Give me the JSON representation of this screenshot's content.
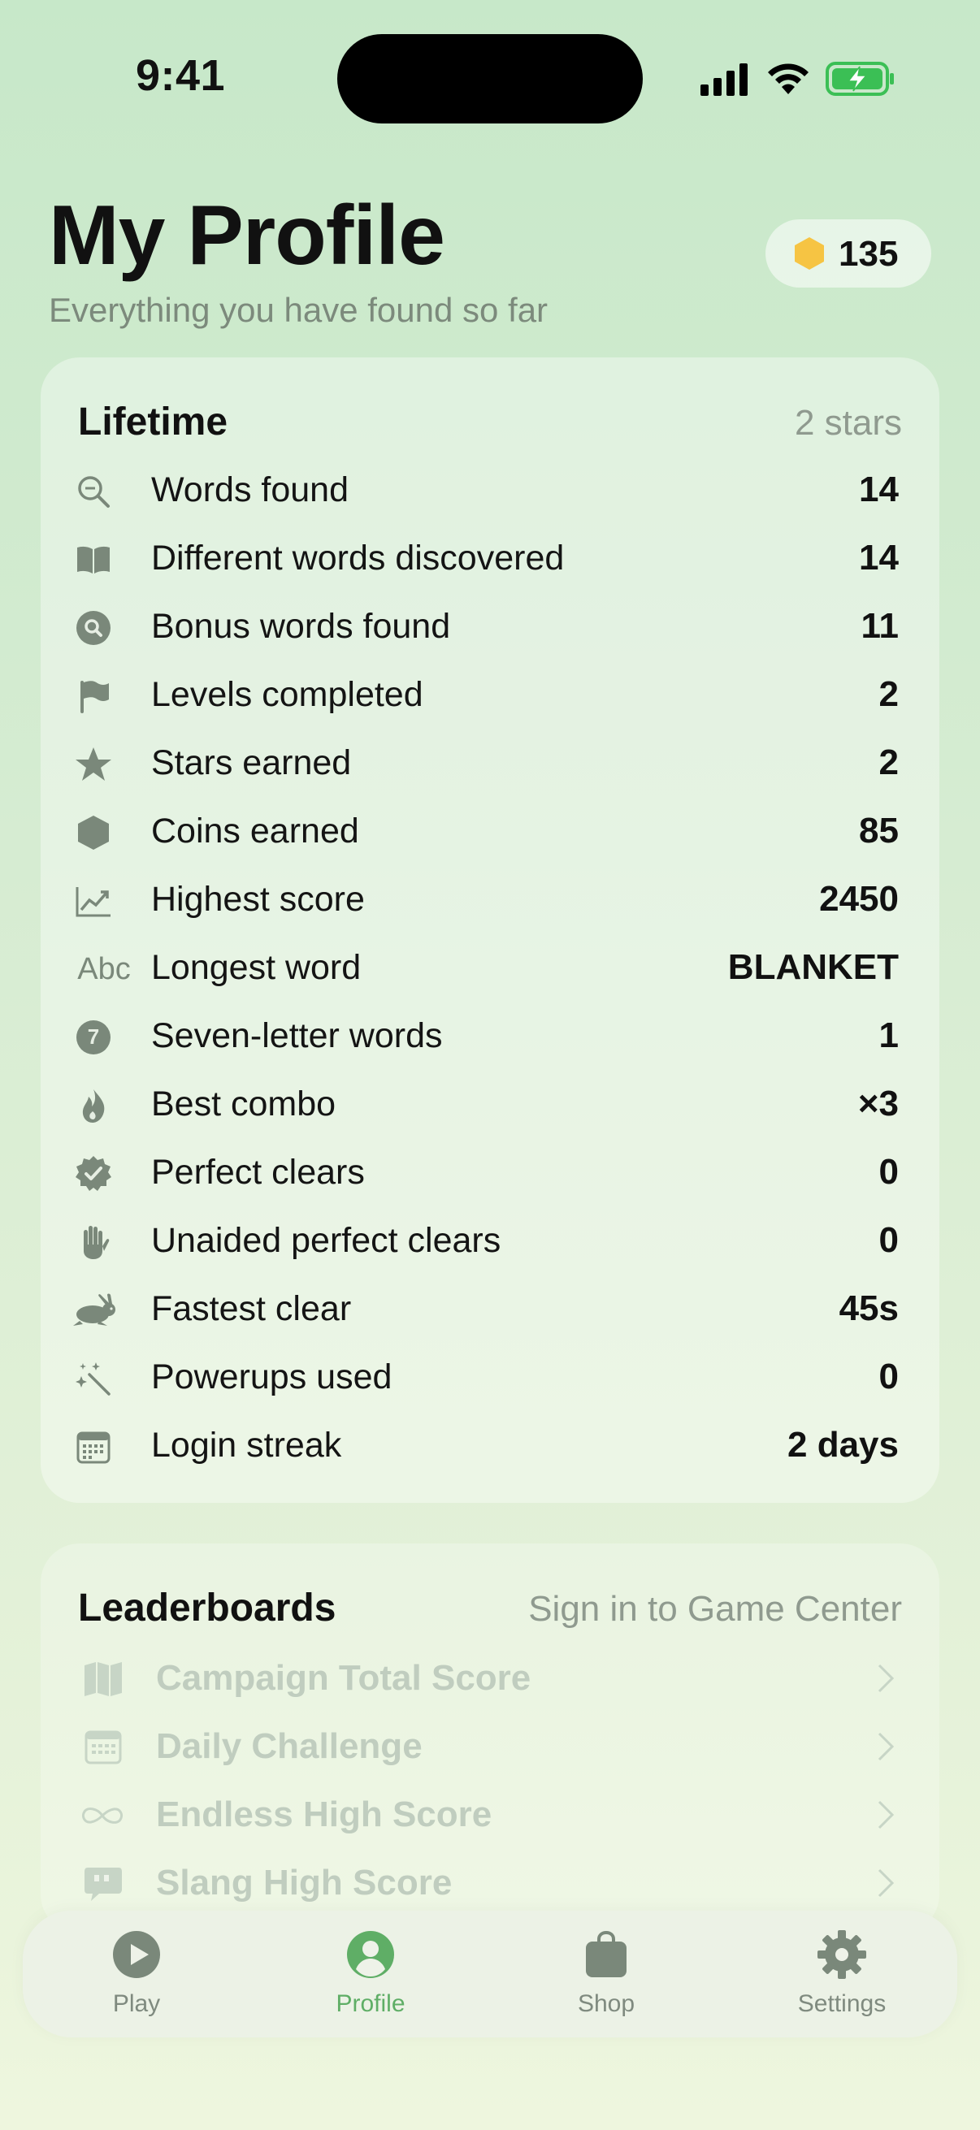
{
  "status_bar": {
    "time": "9:41"
  },
  "header": {
    "title": "My Profile",
    "subtitle": "Everything you have found so far",
    "coins": "135"
  },
  "lifetime": {
    "title": "Lifetime",
    "aside": "2 stars",
    "rows": [
      {
        "icon": "magnifier-icon",
        "label": "Words found",
        "value": "14"
      },
      {
        "icon": "book-icon",
        "label": "Different words discovered",
        "value": "14"
      },
      {
        "icon": "search-circle-icon",
        "label": "Bonus words found",
        "value": "11"
      },
      {
        "icon": "flag-icon",
        "label": "Levels completed",
        "value": "2"
      },
      {
        "icon": "star-icon",
        "label": "Stars earned",
        "value": "2"
      },
      {
        "icon": "hexagon-icon",
        "label": "Coins earned",
        "value": "85"
      },
      {
        "icon": "chart-up-icon",
        "label": "Highest score",
        "value": "2450"
      },
      {
        "icon": "abc-icon",
        "icon_text": "Abc",
        "label": "Longest word",
        "value": "BLANKET"
      },
      {
        "icon": "seven-circle-icon",
        "icon_text": "7",
        "label": "Seven-letter words",
        "value": "1"
      },
      {
        "icon": "flame-icon",
        "label": "Best combo",
        "value": "×3"
      },
      {
        "icon": "checkmark-seal-icon",
        "label": "Perfect clears",
        "value": "0"
      },
      {
        "icon": "hand-icon",
        "label": "Unaided perfect clears",
        "value": "0"
      },
      {
        "icon": "hare-icon",
        "label": "Fastest clear",
        "value": "45s"
      },
      {
        "icon": "magic-wand-icon",
        "label": "Powerups used",
        "value": "0"
      },
      {
        "icon": "calendar-icon",
        "label": "Login streak",
        "value": "2 days"
      }
    ]
  },
  "leaderboards": {
    "title": "Leaderboards",
    "aside": "Sign in to Game Center",
    "rows": [
      {
        "icon": "map-icon",
        "label": "Campaign Total Score"
      },
      {
        "icon": "calendar-icon",
        "label": "Daily Challenge"
      },
      {
        "icon": "infinity-icon",
        "label": "Endless High Score"
      },
      {
        "icon": "quote-bubble-icon",
        "label": "Slang High Score"
      }
    ]
  },
  "tabs": [
    {
      "icon": "play-icon",
      "label": "Play",
      "active": false
    },
    {
      "icon": "person-icon",
      "label": "Profile",
      "active": true
    },
    {
      "icon": "bag-icon",
      "label": "Shop",
      "active": false
    },
    {
      "icon": "gear-icon",
      "label": "Settings",
      "active": false
    }
  ],
  "colors": {
    "accent": "#5fae66",
    "coin": "#f6c443",
    "icon_gray": "#7a887a",
    "muted_text": "#8f9a8f"
  }
}
